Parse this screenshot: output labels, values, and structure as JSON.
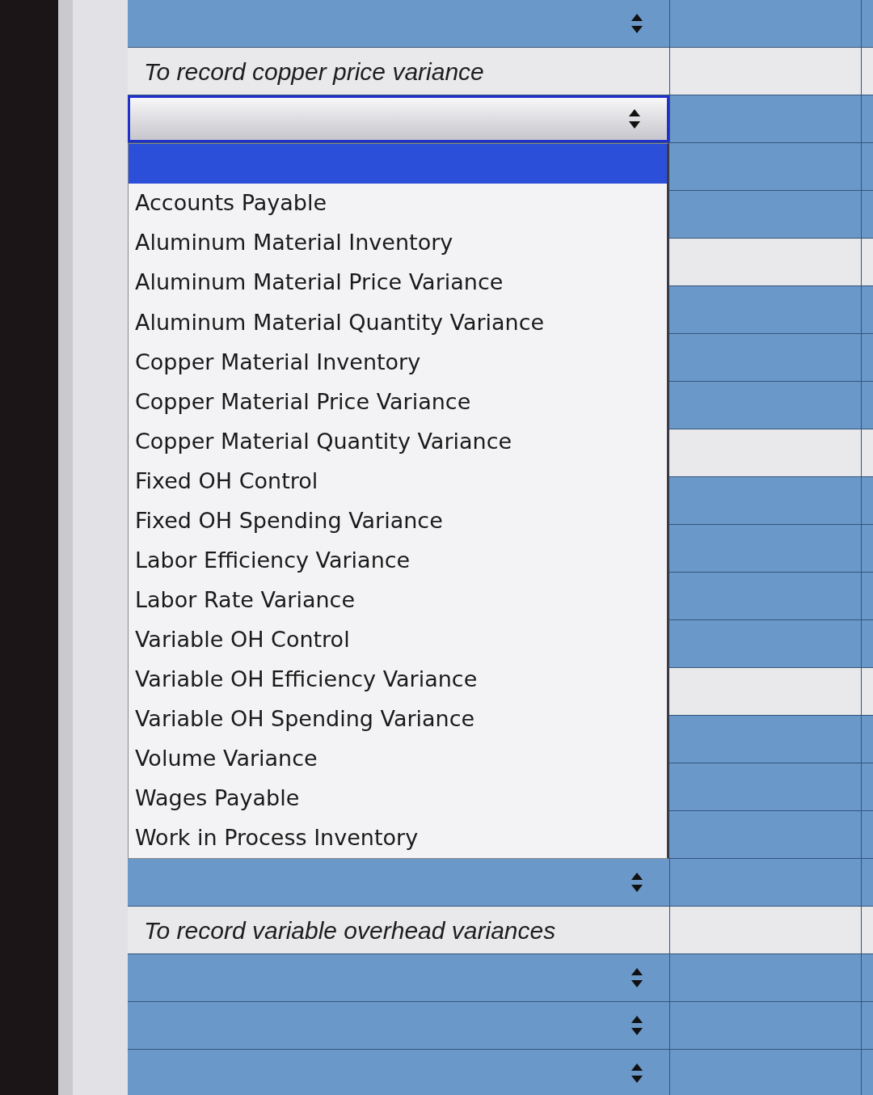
{
  "rows_above": [
    {
      "kind": "account",
      "open": false
    },
    {
      "kind": "note",
      "text": "To record copper price variance"
    },
    {
      "kind": "account",
      "open": true
    }
  ],
  "dropdown": {
    "options": [
      {
        "selected": true
      },
      {
        "label": "Accounts Payable",
        "selected": false
      },
      {
        "label": "Aluminum Material Inventory",
        "selected": false
      },
      {
        "label": "Aluminum Material Price Variance",
        "selected": false
      },
      {
        "label": "Aluminum Material Quantity Variance",
        "selected": false
      },
      {
        "label": "Copper Material Inventory",
        "selected": false
      },
      {
        "label": "Copper Material Price Variance",
        "selected": false
      },
      {
        "label": "Copper Material Quantity Variance",
        "selected": false
      },
      {
        "label": "Fixed OH Control",
        "selected": false
      },
      {
        "label": "Fixed OH Spending Variance",
        "selected": false
      },
      {
        "label": "Labor Efficiency Variance",
        "selected": false
      },
      {
        "label": "Labor Rate Variance",
        "selected": false
      },
      {
        "label": "Variable OH Control",
        "selected": false
      },
      {
        "label": "Variable OH Efficiency Variance",
        "selected": false
      },
      {
        "label": "Variable OH Spending Variance",
        "selected": false
      },
      {
        "label": "Volume Variance",
        "selected": false
      },
      {
        "label": "Wages Payable",
        "selected": false
      },
      {
        "label": "Work in Process Inventory",
        "selected": false
      }
    ],
    "rows_beside": [
      {
        "kind": "account"
      },
      {
        "kind": "account"
      },
      {
        "kind": "note"
      },
      {
        "kind": "account"
      },
      {
        "kind": "account"
      },
      {
        "kind": "account"
      },
      {
        "kind": "note"
      },
      {
        "kind": "account"
      },
      {
        "kind": "account"
      },
      {
        "kind": "account"
      },
      {
        "kind": "account"
      },
      {
        "kind": "note"
      },
      {
        "kind": "account"
      },
      {
        "kind": "account"
      },
      {
        "kind": "account"
      }
    ]
  },
  "rows_below": [
    {
      "kind": "account",
      "open": false
    },
    {
      "kind": "note",
      "text": "To record variable overhead variances"
    },
    {
      "kind": "account",
      "open": false
    },
    {
      "kind": "account",
      "open": false
    },
    {
      "kind": "account",
      "open": false
    }
  ]
}
